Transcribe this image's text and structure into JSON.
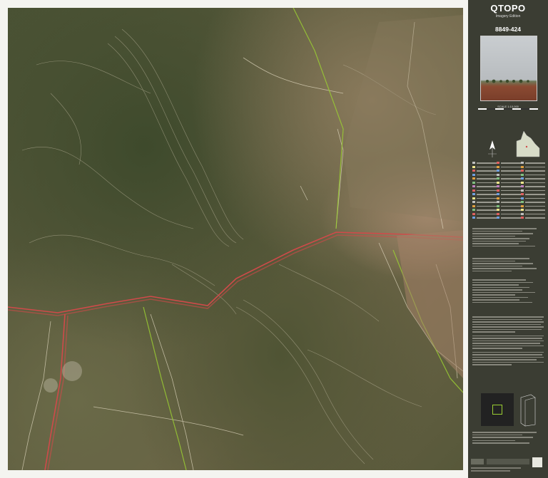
{
  "panel": {
    "title": "QTOPO",
    "subtitle": "Imagery Edition",
    "sheet_number": "8849-424",
    "scale": "SCALE 1:10,000"
  },
  "colors": {
    "panel_bg": "#3b3d33",
    "road_main": "#d04a4a",
    "boundary": "#9acd32",
    "contour": "#c8c0a8",
    "track": "#e8e0c8"
  },
  "icons": {
    "north_arrow": "north-arrow-icon",
    "state_locator": "queensland-locator-icon"
  }
}
